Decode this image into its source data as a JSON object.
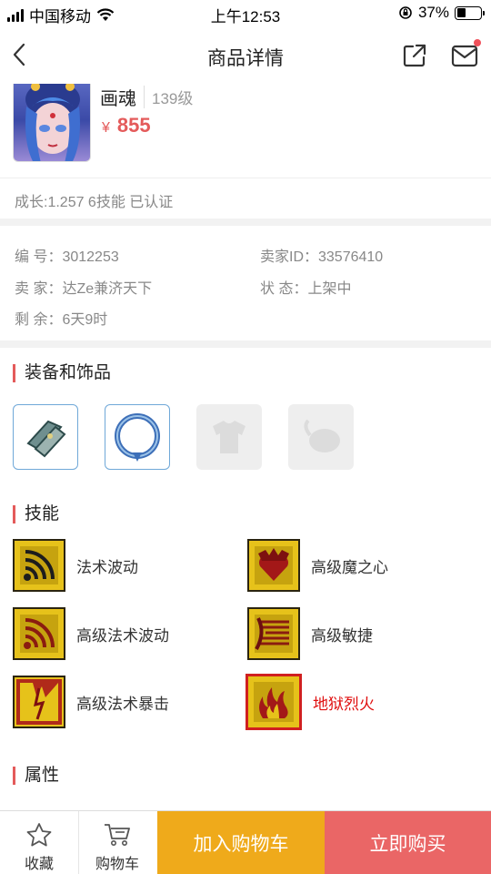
{
  "status": {
    "carrier": "中国移动",
    "time": "上午12:53",
    "battery_text": "37%",
    "battery_level": 0.37
  },
  "nav": {
    "title": "商品详情"
  },
  "product": {
    "name": "画魂",
    "level": "139级",
    "currency": "¥",
    "price": "855",
    "growth": "成长:1.257 6技能 已认证"
  },
  "info": {
    "id": "编 号：3012253",
    "seller_id": "卖家ID：33576410",
    "seller": "卖 家：达Ze兼济天下",
    "state": "状 态：上架中",
    "remaining": "剩 余：6天9时"
  },
  "sections": {
    "equipment": "装备和饰品",
    "skills": "技能",
    "attributes": "属性"
  },
  "skills": [
    {
      "label": "法术波动"
    },
    {
      "label": "高级魔之心"
    },
    {
      "label": "高级法术波动"
    },
    {
      "label": "高级敏捷"
    },
    {
      "label": "高级法术暴击"
    },
    {
      "label": "地狱烈火"
    }
  ],
  "bottom": {
    "favorite": "收藏",
    "cart": "购物车",
    "add_cart": "加入购物车",
    "buy_now": "立即购买"
  },
  "colors": {
    "accent": "#e45b5b",
    "add_cart_bg": "#efaa1b",
    "buy_bg": "#ea6666",
    "skill_yellow": "#e8c21c"
  }
}
